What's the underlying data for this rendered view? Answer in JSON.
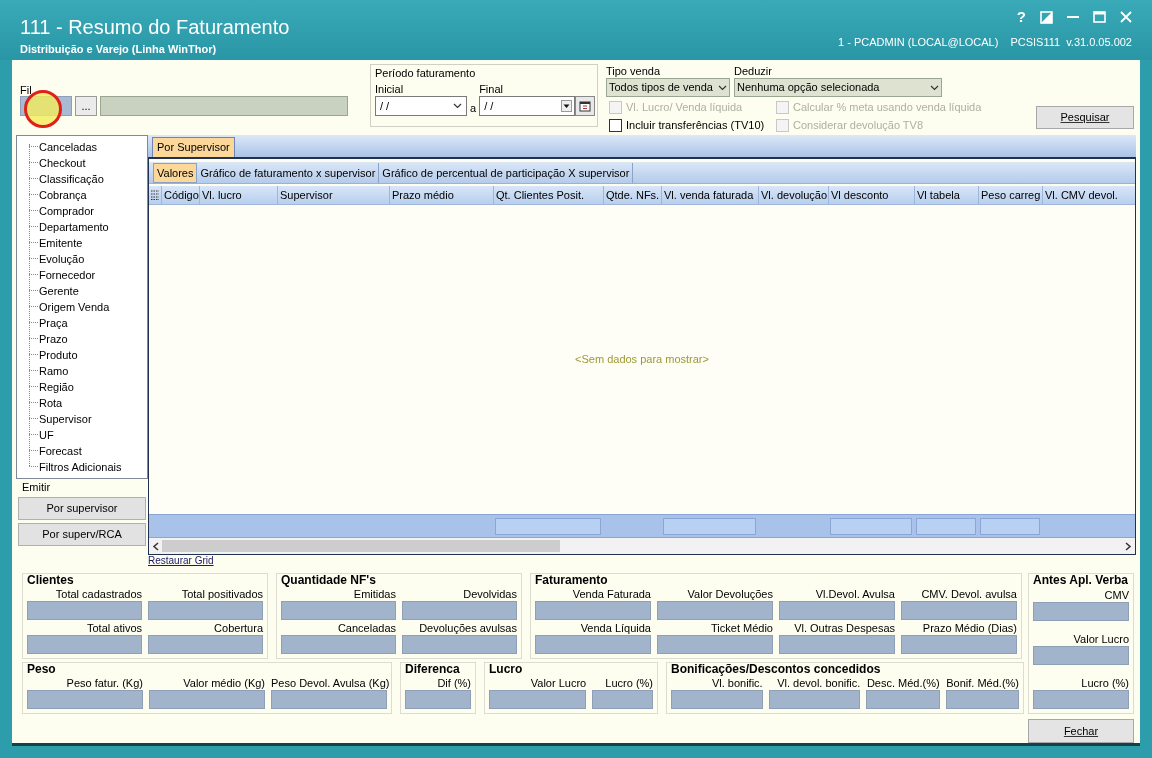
{
  "window": {
    "title": "111 - Resumo do Faturamento",
    "subtitle": "Distribuição e Varejo (Linha WinThor)",
    "user_info": "1 - PCADMIN (LOCAL@LOCAL)",
    "program": "PCSIS111",
    "version": "v.31.0.05.002",
    "help": "?"
  },
  "filters": {
    "filial": {
      "label": "Fil",
      "browse": "..."
    },
    "period": {
      "title": "Período faturamento",
      "start_label": "Inicial",
      "start_value": "/ /",
      "connector": "a",
      "end_label": "Final",
      "end_value": "/ /"
    },
    "sale_type": {
      "label": "Tipo venda",
      "value": "Todos tipos de venda"
    },
    "deduct": {
      "label": "Deduzir",
      "value": "Nenhuma opção selecionada"
    },
    "options": [
      {
        "label": "Vl. Lucro/ Venda líquida",
        "checked": false,
        "disabled": true
      },
      {
        "label": "Incluir transferências (TV10)",
        "checked": false,
        "disabled": false
      },
      {
        "label": "Calcular % meta usando venda líquida",
        "checked": false,
        "disabled": true
      },
      {
        "label": "Considerar devolução TV8",
        "checked": false,
        "disabled": true
      }
    ],
    "search_button": "Pesquisar"
  },
  "sidebar": {
    "items": [
      "Canceladas",
      "Checkout",
      "Classificação",
      "Cobrança",
      "Comprador",
      "Departamento",
      "Emitente",
      "Evolução",
      "Fornecedor",
      "Gerente",
      "Origem Venda",
      "Praça",
      "Prazo",
      "Produto",
      "Ramo",
      "Região",
      "Rota",
      "Supervisor",
      "UF",
      "Forecast",
      "Filtros Adicionais"
    ],
    "emit_label": "Emitir",
    "buttons": [
      "Por supervisor",
      "Por superv/RCA"
    ]
  },
  "main": {
    "tabs": [
      {
        "label": "Por Supervisor",
        "selected": true
      }
    ],
    "subtabs": [
      {
        "label": "Valores",
        "selected": true
      },
      {
        "label": "Gráfico de faturamento x supervisor",
        "selected": false
      },
      {
        "label": "Gráfico de percentual de participação X supervisor",
        "selected": false
      }
    ],
    "table": {
      "columns": [
        "Código",
        "Vl. lucro",
        "Supervisor",
        "Prazo médio",
        "Qt. Clientes Posit.",
        "Qtde. NFs.",
        "Vl. venda faturada",
        "Vl. devolução",
        "Vl desconto",
        "Vl tabela",
        "Peso carreg",
        "Vl. CMV devol."
      ],
      "empty_message": "<Sem dados para mostrar>"
    },
    "restore_link": "Restaurar Grid"
  },
  "summary": {
    "row_1": [
      {
        "title": "Clientes",
        "fields": [
          "Total cadastrados",
          "Total positivados",
          "Total ativos",
          "Cobertura"
        ]
      },
      {
        "title": "Quantidade NF's",
        "fields": [
          "Emitidas",
          "Devolvidas",
          "Canceladas",
          "Devoluções avulsas"
        ]
      },
      {
        "title": "Faturamento",
        "fields": [
          "Venda Faturada",
          "Valor Devoluções",
          "Vl.Devol. Avulsa",
          "CMV. Devol. avulsa",
          "Venda Líquida",
          "Ticket Médio",
          "Vl. Outras Despesas",
          "Prazo Médio (Dias)"
        ]
      }
    ],
    "row_2": [
      {
        "title": "Peso",
        "fields": [
          "Peso fatur. (Kg)",
          "Valor médio (Kg)",
          "Peso Devol. Avulsa (Kg)"
        ]
      },
      {
        "title": "Diferenca",
        "fields": [
          "Dif (%)"
        ]
      },
      {
        "title": "Lucro",
        "fields": [
          "Valor Lucro",
          "Lucro (%)"
        ]
      },
      {
        "title": "Bonificações/Descontos concedidos",
        "fields": [
          "Vl. bonific.",
          "Vl. devol. bonific.",
          "Desc. Méd.(%)",
          "Bonif. Méd.(%)"
        ]
      }
    ],
    "side": {
      "title": "Antes Apl. Verba",
      "fields": [
        "CMV",
        "Valor Lucro",
        "Lucro (%)"
      ]
    }
  },
  "close_button": "Fechar"
}
